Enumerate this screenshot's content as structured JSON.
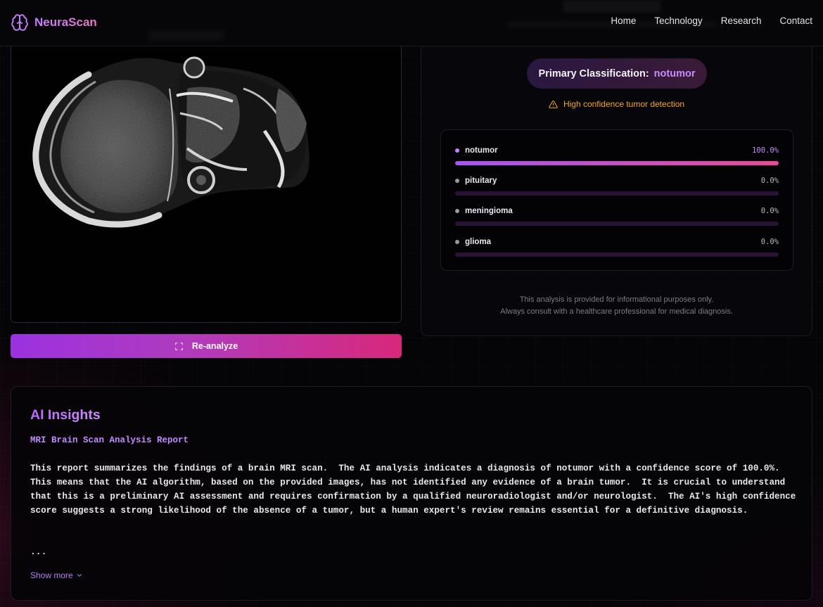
{
  "nav": {
    "brand": "NeuraScan",
    "links": [
      "Home",
      "Technology",
      "Research",
      "Contact"
    ]
  },
  "scan": {
    "button_label": "Re-analyze"
  },
  "result": {
    "classification_label": "Primary Classification:",
    "classification_value": "notumor",
    "warning": "High confidence tumor detection",
    "probabilities": [
      {
        "name": "notumor",
        "value_text": "100.0%",
        "value": 1.0,
        "active": true
      },
      {
        "name": "pituitary",
        "value_text": "0.0%",
        "value": 0.0,
        "active": false
      },
      {
        "name": "meningioma",
        "value_text": "0.0%",
        "value": 0.0,
        "active": false
      },
      {
        "name": "glioma",
        "value_text": "0.0%",
        "value": 0.0,
        "active": false
      }
    ],
    "disclaimer_line1": "This analysis is provided for informational purposes only.",
    "disclaimer_line2": "Always consult with a healthcare professional for medical diagnosis."
  },
  "insights": {
    "heading": "AI Insights",
    "report_title": "MRI Brain Scan Analysis Report",
    "body": "This report summarizes the findings of a brain MRI scan.  The AI analysis indicates a diagnosis of notumor with a confidence score of 100.0%.  This means that the AI algorithm, based on the provided images, has not identified any evidence of a brain tumor.  It is crucial to understand that this is a preliminary AI assessment and requires confirmation by a qualified neuroradiologist and/or neurologist.  The AI's high confidence score suggests a strong likelihood of the absence of a tumor, but a human expert's review remains essential for a definitive diagnosis.",
    "ellipsis": "...",
    "show_more": "Show more"
  },
  "colors": {
    "accent_purple": "#c084fc",
    "accent_pink": "#ec4899",
    "warning": "#f5a524"
  }
}
